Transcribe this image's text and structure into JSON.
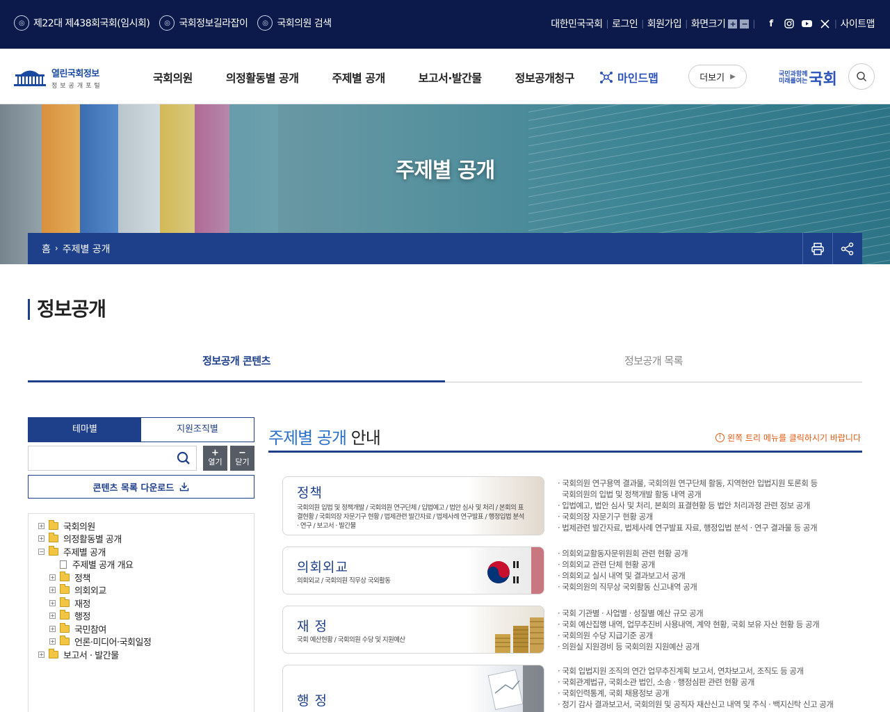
{
  "topbar": {
    "left": [
      {
        "label": "제22대 제438회국회(임시회)"
      },
      {
        "label": "국회정보길라잡이"
      },
      {
        "label": "국회의원 검색"
      }
    ],
    "right": {
      "links": [
        "대한민국국회",
        "로그인",
        "회원가입"
      ],
      "zoom_label": "화면크기",
      "zoom_in": "+",
      "zoom_out": "−",
      "sitemap": "사이트맵"
    }
  },
  "gnb": {
    "logo_main": "열린국회정보",
    "logo_sub": "정보공개포털",
    "menu": [
      "국회의원",
      "의정활동별 공개",
      "주제별 공개",
      "보고서·발간물",
      "정보공개청구"
    ],
    "mindmap": "마인드맵",
    "more": "더보기",
    "brand_small1": "국민과함께",
    "brand_small2": "미래를여는",
    "brand_big": "국회"
  },
  "hero": {
    "title": "주제별 공개",
    "crumb_home": "홈",
    "crumb_current": "주제별 공개"
  },
  "page": {
    "title": "정보공개",
    "tabs": [
      "정보공개 콘텐츠",
      "정보공개 목록"
    ]
  },
  "left": {
    "tabs": [
      "테마별",
      "지원조직별"
    ],
    "search_placeholder": "",
    "open": "열기",
    "close": "닫기",
    "open_sym": "+",
    "close_sym": "−",
    "download": "콘텐츠 목록 다운로드",
    "tree": [
      {
        "label": "국회의원",
        "level": 0,
        "type": "folder",
        "pm": "+"
      },
      {
        "label": "의정활동별 공개",
        "level": 0,
        "type": "folder",
        "pm": "+"
      },
      {
        "label": "주제별 공개",
        "level": 0,
        "type": "folder-open",
        "pm": "−"
      },
      {
        "label": "주제별 공개 개요",
        "level": 1,
        "type": "doc",
        "pm": ""
      },
      {
        "label": "정책",
        "level": 1,
        "type": "folder",
        "pm": "+"
      },
      {
        "label": "의회외교",
        "level": 1,
        "type": "folder",
        "pm": "+"
      },
      {
        "label": "재정",
        "level": 1,
        "type": "folder",
        "pm": "+"
      },
      {
        "label": "행정",
        "level": 1,
        "type": "folder",
        "pm": "+"
      },
      {
        "label": "국민참여",
        "level": 1,
        "type": "folder",
        "pm": "+"
      },
      {
        "label": "언론·미디어·국회일정",
        "level": 1,
        "type": "folder",
        "pm": "+"
      },
      {
        "label": "보고서 · 발간물",
        "level": 0,
        "type": "folder",
        "pm": "+"
      }
    ]
  },
  "content": {
    "title_hl": "주제별 공개",
    "title_rest": " 안내",
    "note": "왼쪽 트리 메뉴를 클릭하시기 바랍니다",
    "cards": [
      {
        "title": "정책",
        "sub": "국회의원 입법 및 정책개발 / 국회의원 연구단체 / 입법예고 / 법안 심사 및 처리 / 본회의 표결현황 / 국회의장 자문기구 현황 / 법제관련 발간자료 / 법제사례 연구발표 / 행정입법 분석 · 연구 / 보고서 · 발간물",
        "desc": [
          "· 국회의원 연구용역 결과물, 국회의원 연구단체 활동, 지역현안 입법지원 토론회 등",
          "  국회의원의 입법 및 정책개발 활동 내역 공개",
          "· 입법예고, 법안 심사 및 처리, 본회의 표결현황 등 법안 처리과정 관련 정보 공개",
          "· 국회의장 자문기구 현황 공개",
          "· 법제관련 발간자료, 법제사례 연구발표 자료, 행정입법 분석 · 연구 결과물 등 공개"
        ]
      },
      {
        "title": "의회외교",
        "sub": "의회외교 / 국회의원 직무상 국외활동",
        "desc": [
          "· 의회외교활동자문위원회 관련 현황 공개",
          "· 의회외교 관련 단체 현황 공개",
          "· 의회외교 실시 내역 및 결과보고서 공개",
          "· 국회의원의 직무상 국외활동 신고내역 공개"
        ]
      },
      {
        "title": "재 정",
        "sub": "국회 예산현황 / 국회의원 수당 및 지원예산",
        "desc": [
          "· 국회 기관별 · 사업별 · 성질별 예산 규모 공개",
          "· 국회 예산집행 내역, 업무추진비 사용내역, 계약 현황, 국회 보유 자산 현황 등 공개",
          "· 국회의원 수당 지급기준 공개",
          "· 의원실 지원경비 등 국회의원 지원예산 공개"
        ]
      },
      {
        "title": "행 정",
        "sub": "",
        "desc": [
          "· 국회 입법지원 조직의 연간 업무추진계획 보고서, 연차보고서, 조직도 등 공개",
          "· 국회관계법규, 국회소관 법인, 소송 · 행정심판 관련 현황 공개",
          "· 국회인력통계, 국회 채용정보 공개",
          "· 정기 감사 결과보고서, 국회의원 및 공직자 재산신고 내역 및 주식 · 백지신탁 신고 공개"
        ]
      }
    ]
  }
}
